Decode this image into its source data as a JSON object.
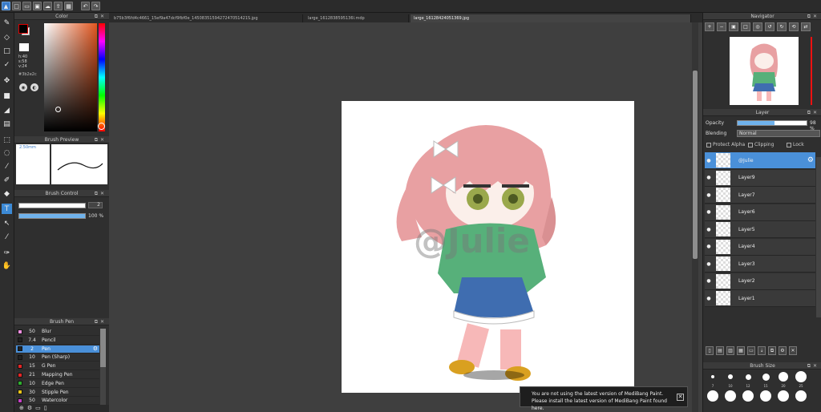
{
  "colors": {
    "accent": "#4a90d9",
    "panel_bg": "#2f2f2f",
    "canvas_bg": "#3f3f3f"
  },
  "toolbar": {
    "icons": [
      "app-icon",
      "new-icon",
      "open-icon",
      "save-icon",
      "cloud-icon",
      "share-icon",
      "grid-icon",
      "undo-icon",
      "redo-icon"
    ]
  },
  "tools": [
    "brush-tool",
    "eraser-tool",
    "select-rect-tool",
    "select-magic-tool",
    "move-tool",
    "fill-rect-tool",
    "bucket-tool",
    "gradient-tool",
    "lasso-tool",
    "wand-tool",
    "select-pen-tool",
    "select-eraser-tool",
    "text-tool",
    "operation-tool",
    "eyedropper-tool",
    "divide-tool",
    "hand-tool"
  ],
  "color_panel": {
    "title": "Color",
    "h": "h:40",
    "s": "s:58",
    "v": "v:24",
    "hex": "#3b2e2c"
  },
  "brush_preview": {
    "title": "Brush Preview",
    "size": "2.50mm"
  },
  "brush_control": {
    "title": "Brush Control",
    "size_value": "2",
    "opacity_value": "100 %",
    "opacity_fraction": 1.0,
    "size_fraction": 0.97
  },
  "brush_list": {
    "title": "Brush Pen",
    "items": [
      {
        "size": "50",
        "name": "Blur",
        "color": "#f08ee0"
      },
      {
        "size": "7.4",
        "name": "Pencil",
        "color": "#222222"
      },
      {
        "size": "2",
        "name": "Pen",
        "color": "#222222",
        "selected": true
      },
      {
        "size": "10",
        "name": "Pen (Sharp)",
        "color": "#222222"
      },
      {
        "size": "15",
        "name": "G Pen",
        "color": "#e32626"
      },
      {
        "size": "21",
        "name": "Mapping Pen",
        "color": "#e32626"
      },
      {
        "size": "10",
        "name": "Edge Pen",
        "color": "#2fae2f"
      },
      {
        "size": "30",
        "name": "Stipple Pen",
        "color": "#e8c41a"
      },
      {
        "size": "50",
        "name": "Watercolor",
        "color": "#c640c6"
      }
    ]
  },
  "tabs": [
    {
      "label": "b75b3f6fd4c4661_15ef9a47dcf9fbf0e_1450835159427247051421S.jpg"
    },
    {
      "label": "large_1612838595136l.mdp"
    },
    {
      "label": "large_16128424051369.jpg",
      "active": true
    }
  ],
  "canvas": {
    "watermark": "@Julie"
  },
  "notice": {
    "line1": "You are not using the latest version of MediBang Paint.",
    "line2": "Please install the latest version of MediBang Paint found here."
  },
  "navigator": {
    "title": "Navigator"
  },
  "layer_panel": {
    "title": "Layer",
    "opacity_label": "Opacity",
    "opacity_value": "98 %",
    "opacity_fraction": 0.98,
    "blending_label": "Blending",
    "blending_value": "Normal",
    "protect_alpha": "Protect Alpha",
    "clipping": "Clipping",
    "lock": "Lock",
    "layers": [
      {
        "name": "@Julie",
        "selected": true
      },
      {
        "name": "Layer9"
      },
      {
        "name": "Layer7"
      },
      {
        "name": "Layer6"
      },
      {
        "name": "Layer5"
      },
      {
        "name": "Layer4"
      },
      {
        "name": "Layer3"
      },
      {
        "name": "Layer2"
      },
      {
        "name": "Layer1"
      }
    ]
  },
  "brush_size": {
    "title": "Brush Size",
    "labels": [
      "7",
      "10",
      "12",
      "15",
      "20",
      "25"
    ]
  }
}
